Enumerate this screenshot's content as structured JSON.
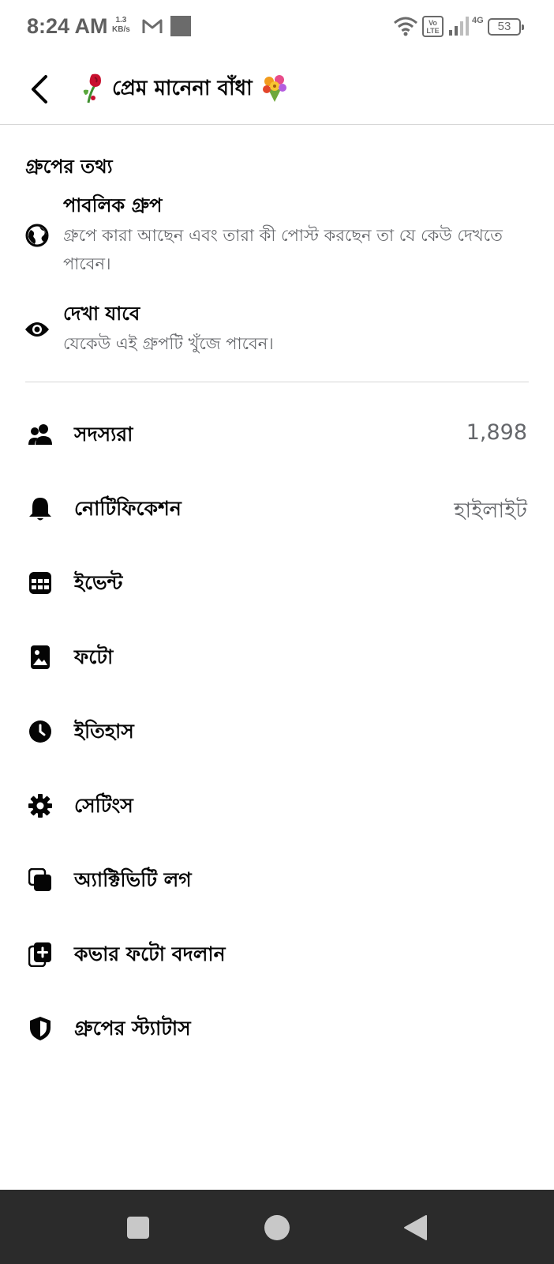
{
  "status_bar": {
    "time": "8:24 AM",
    "speed_value": "1.3",
    "speed_unit": "KB/s",
    "network": "4G",
    "battery": "53"
  },
  "header": {
    "title": "প্রেম মানেনা বাঁধা"
  },
  "group_info": {
    "heading": "গ্রুপের তথ্য",
    "privacy_title": "পাবলিক গ্রুপ",
    "privacy_desc": "গ্রুপে কারা আছেন এবং তারা কী পোস্ট করছেন তা যে কেউ দেখতে পাবেন।",
    "visibility_title": "দেখা যাবে",
    "visibility_desc": "যেকেউ এই গ্রুপটি খুঁজে পাবেন।"
  },
  "menu": {
    "members_label": "সদস্যরা",
    "members_count": "1,898",
    "notifications_label": "নোটিফিকেশন",
    "notifications_value": "হাইলাইট",
    "events_label": "ইভেন্ট",
    "photos_label": "ফটো",
    "history_label": "ইতিহাস",
    "settings_label": "সেটিংস",
    "activity_log_label": "অ্যাক্টিভিটি লগ",
    "change_cover_label": "কভার ফটো বদলান",
    "group_status_label": "গ্রুপের স্ট্যাটাস"
  },
  "colors": {
    "text_primary": "#050505",
    "text_secondary": "#65676b",
    "divider": "#d6d6d6",
    "navbar": "#2b2b2b"
  }
}
